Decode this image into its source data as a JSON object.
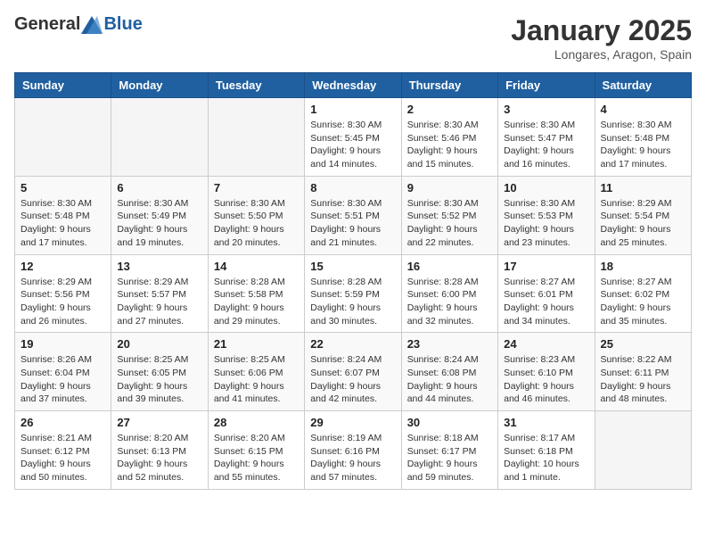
{
  "logo": {
    "general": "General",
    "blue": "Blue"
  },
  "header": {
    "month": "January 2025",
    "location": "Longares, Aragon, Spain"
  },
  "weekdays": [
    "Sunday",
    "Monday",
    "Tuesday",
    "Wednesday",
    "Thursday",
    "Friday",
    "Saturday"
  ],
  "weeks": [
    [
      {
        "day": "",
        "info": ""
      },
      {
        "day": "",
        "info": ""
      },
      {
        "day": "",
        "info": ""
      },
      {
        "day": "1",
        "info": "Sunrise: 8:30 AM\nSunset: 5:45 PM\nDaylight: 9 hours\nand 14 minutes."
      },
      {
        "day": "2",
        "info": "Sunrise: 8:30 AM\nSunset: 5:46 PM\nDaylight: 9 hours\nand 15 minutes."
      },
      {
        "day": "3",
        "info": "Sunrise: 8:30 AM\nSunset: 5:47 PM\nDaylight: 9 hours\nand 16 minutes."
      },
      {
        "day": "4",
        "info": "Sunrise: 8:30 AM\nSunset: 5:48 PM\nDaylight: 9 hours\nand 17 minutes."
      }
    ],
    [
      {
        "day": "5",
        "info": "Sunrise: 8:30 AM\nSunset: 5:48 PM\nDaylight: 9 hours\nand 17 minutes."
      },
      {
        "day": "6",
        "info": "Sunrise: 8:30 AM\nSunset: 5:49 PM\nDaylight: 9 hours\nand 19 minutes."
      },
      {
        "day": "7",
        "info": "Sunrise: 8:30 AM\nSunset: 5:50 PM\nDaylight: 9 hours\nand 20 minutes."
      },
      {
        "day": "8",
        "info": "Sunrise: 8:30 AM\nSunset: 5:51 PM\nDaylight: 9 hours\nand 21 minutes."
      },
      {
        "day": "9",
        "info": "Sunrise: 8:30 AM\nSunset: 5:52 PM\nDaylight: 9 hours\nand 22 minutes."
      },
      {
        "day": "10",
        "info": "Sunrise: 8:30 AM\nSunset: 5:53 PM\nDaylight: 9 hours\nand 23 minutes."
      },
      {
        "day": "11",
        "info": "Sunrise: 8:29 AM\nSunset: 5:54 PM\nDaylight: 9 hours\nand 25 minutes."
      }
    ],
    [
      {
        "day": "12",
        "info": "Sunrise: 8:29 AM\nSunset: 5:56 PM\nDaylight: 9 hours\nand 26 minutes."
      },
      {
        "day": "13",
        "info": "Sunrise: 8:29 AM\nSunset: 5:57 PM\nDaylight: 9 hours\nand 27 minutes."
      },
      {
        "day": "14",
        "info": "Sunrise: 8:28 AM\nSunset: 5:58 PM\nDaylight: 9 hours\nand 29 minutes."
      },
      {
        "day": "15",
        "info": "Sunrise: 8:28 AM\nSunset: 5:59 PM\nDaylight: 9 hours\nand 30 minutes."
      },
      {
        "day": "16",
        "info": "Sunrise: 8:28 AM\nSunset: 6:00 PM\nDaylight: 9 hours\nand 32 minutes."
      },
      {
        "day": "17",
        "info": "Sunrise: 8:27 AM\nSunset: 6:01 PM\nDaylight: 9 hours\nand 34 minutes."
      },
      {
        "day": "18",
        "info": "Sunrise: 8:27 AM\nSunset: 6:02 PM\nDaylight: 9 hours\nand 35 minutes."
      }
    ],
    [
      {
        "day": "19",
        "info": "Sunrise: 8:26 AM\nSunset: 6:04 PM\nDaylight: 9 hours\nand 37 minutes."
      },
      {
        "day": "20",
        "info": "Sunrise: 8:25 AM\nSunset: 6:05 PM\nDaylight: 9 hours\nand 39 minutes."
      },
      {
        "day": "21",
        "info": "Sunrise: 8:25 AM\nSunset: 6:06 PM\nDaylight: 9 hours\nand 41 minutes."
      },
      {
        "day": "22",
        "info": "Sunrise: 8:24 AM\nSunset: 6:07 PM\nDaylight: 9 hours\nand 42 minutes."
      },
      {
        "day": "23",
        "info": "Sunrise: 8:24 AM\nSunset: 6:08 PM\nDaylight: 9 hours\nand 44 minutes."
      },
      {
        "day": "24",
        "info": "Sunrise: 8:23 AM\nSunset: 6:10 PM\nDaylight: 9 hours\nand 46 minutes."
      },
      {
        "day": "25",
        "info": "Sunrise: 8:22 AM\nSunset: 6:11 PM\nDaylight: 9 hours\nand 48 minutes."
      }
    ],
    [
      {
        "day": "26",
        "info": "Sunrise: 8:21 AM\nSunset: 6:12 PM\nDaylight: 9 hours\nand 50 minutes."
      },
      {
        "day": "27",
        "info": "Sunrise: 8:20 AM\nSunset: 6:13 PM\nDaylight: 9 hours\nand 52 minutes."
      },
      {
        "day": "28",
        "info": "Sunrise: 8:20 AM\nSunset: 6:15 PM\nDaylight: 9 hours\nand 55 minutes."
      },
      {
        "day": "29",
        "info": "Sunrise: 8:19 AM\nSunset: 6:16 PM\nDaylight: 9 hours\nand 57 minutes."
      },
      {
        "day": "30",
        "info": "Sunrise: 8:18 AM\nSunset: 6:17 PM\nDaylight: 9 hours\nand 59 minutes."
      },
      {
        "day": "31",
        "info": "Sunrise: 8:17 AM\nSunset: 6:18 PM\nDaylight: 10 hours\nand 1 minute."
      },
      {
        "day": "",
        "info": ""
      }
    ]
  ]
}
